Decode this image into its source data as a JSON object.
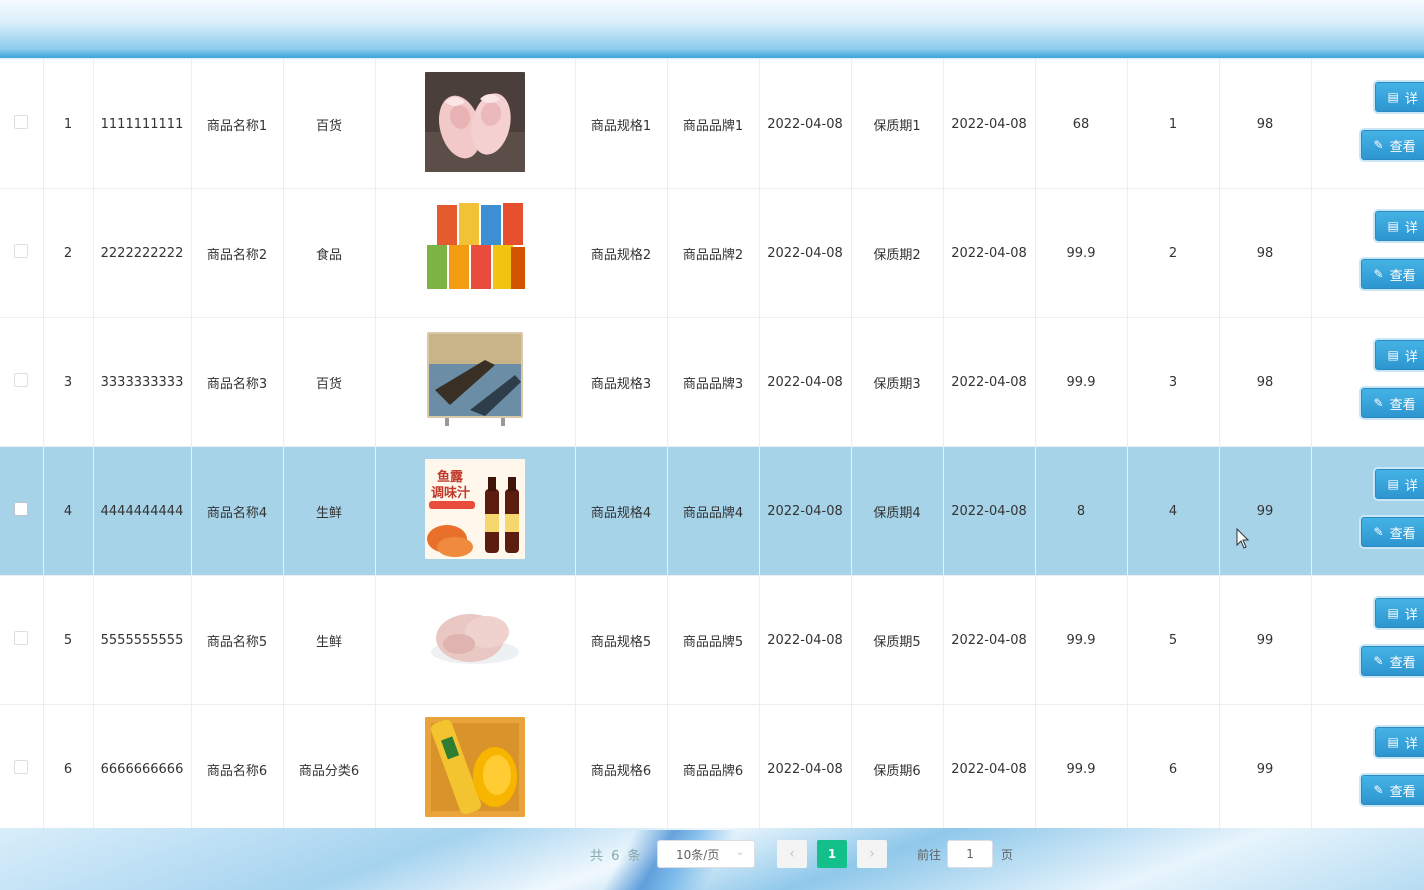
{
  "rows": [
    {
      "index": "1",
      "code": "1111111111",
      "name": "商品名称1",
      "category": "百货",
      "image": "pink-shoes",
      "spec": "商品规格1",
      "brand": "商品品牌1",
      "date1": "2022-04-08",
      "shelf": "保质期1",
      "date2": "2022-04-08",
      "price": "68",
      "qty": "1",
      "score": "98",
      "selected": false
    },
    {
      "index": "2",
      "code": "2222222222",
      "name": "商品名称2",
      "category": "食品",
      "image": "snack-boxes",
      "spec": "商品规格2",
      "brand": "商品品牌2",
      "date1": "2022-04-08",
      "shelf": "保质期2",
      "date2": "2022-04-08",
      "price": "99.9",
      "qty": "2",
      "score": "98",
      "selected": false
    },
    {
      "index": "3",
      "code": "3333333333",
      "name": "商品名称3",
      "category": "百货",
      "image": "tv-boat",
      "spec": "商品规格3",
      "brand": "商品品牌3",
      "date1": "2022-04-08",
      "shelf": "保质期3",
      "date2": "2022-04-08",
      "price": "99.9",
      "qty": "3",
      "score": "98",
      "selected": false
    },
    {
      "index": "4",
      "code": "4444444444",
      "name": "商品名称4",
      "category": "生鲜",
      "image": "fish-sauce",
      "image_text": "鱼露\n调味汁",
      "spec": "商品规格4",
      "brand": "商品品牌4",
      "date1": "2022-04-08",
      "shelf": "保质期4",
      "date2": "2022-04-08",
      "price": "8",
      "qty": "4",
      "score": "99",
      "selected": true
    },
    {
      "index": "5",
      "code": "5555555555",
      "name": "商品名称5",
      "category": "生鲜",
      "image": "chicken",
      "spec": "商品规格5",
      "brand": "商品品牌5",
      "date1": "2022-04-08",
      "shelf": "保质期5",
      "date2": "2022-04-08",
      "price": "99.9",
      "qty": "5",
      "score": "99",
      "selected": false
    },
    {
      "index": "6",
      "code": "6666666666",
      "name": "商品名称6",
      "category": "商品分类6",
      "image": "chips-mango",
      "spec": "商品规格6",
      "brand": "商品品牌6",
      "date1": "2022-04-08",
      "shelf": "保质期6",
      "date2": "2022-04-08",
      "price": "99.9",
      "qty": "6",
      "score": "99",
      "selected": false
    }
  ],
  "actions": {
    "detail_label": "详",
    "detail_icon": "document-icon",
    "view_label": "查看",
    "view_icon": "edit-icon"
  },
  "pagination": {
    "total_label": "共 6 条",
    "page_size": "10条/页",
    "current_page": "1",
    "goto_label": "前往",
    "goto_value": "1",
    "page_suffix": "页"
  },
  "colors": {
    "accent": "#2d95cf",
    "selected_row": "#a6d3e8",
    "page_active": "#13c08a"
  }
}
